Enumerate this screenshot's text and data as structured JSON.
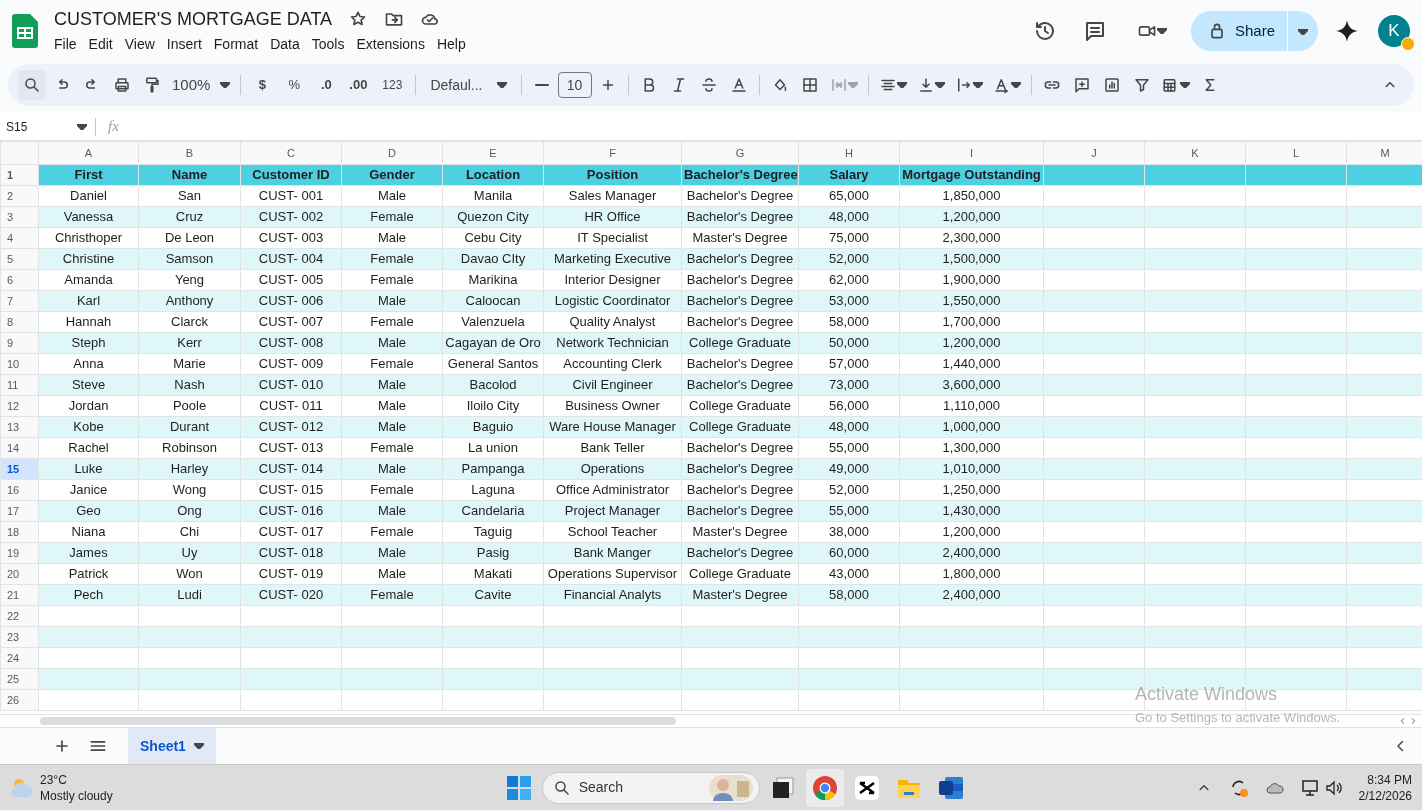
{
  "document": {
    "title": "CUSTOMER'S MORTGAGE DATA",
    "share": "Share",
    "avatar": "K"
  },
  "menu": [
    "File",
    "Edit",
    "View",
    "Insert",
    "Format",
    "Data",
    "Tools",
    "Extensions",
    "Help"
  ],
  "toolbar": {
    "zoom": "100%",
    "currency": "$",
    "percent": "%",
    "decrease_decimals": ".0",
    "increase_decimals": ".00",
    "number_format": "123",
    "font": "Defaul...",
    "font_size": "10"
  },
  "formula_bar": {
    "name_box": "S15",
    "fx": "fx"
  },
  "table": {
    "columns": [
      "A",
      "B",
      "C",
      "D",
      "E",
      "F",
      "G",
      "H",
      "I",
      "J",
      "K",
      "L",
      "M"
    ],
    "rows": [
      {
        "number": "1",
        "selected": false,
        "kind": "header",
        "cells": [
          "First",
          "Name",
          "Customer ID",
          "Gender",
          "Location",
          "Position",
          "Bachelor's Degree",
          "Salary",
          "Mortgage Outstanding"
        ]
      },
      {
        "number": "2",
        "selected": false,
        "kind": "data",
        "cells": [
          "Daniel",
          "San",
          "CUST- 001",
          "Male",
          "Manila",
          "Sales Manager",
          "Bachelor's Degree",
          "65,000",
          "1,850,000"
        ]
      },
      {
        "number": "3",
        "selected": false,
        "kind": "data",
        "cells": [
          "Vanessa",
          "Cruz",
          "CUST- 002",
          "Female",
          "Quezon City",
          "HR Office",
          "Bachelor's Degree",
          "48,000",
          "1,200,000"
        ]
      },
      {
        "number": "4",
        "selected": false,
        "kind": "data",
        "cells": [
          "Christhoper",
          "De Leon",
          "CUST- 003",
          "Male",
          "Cebu City",
          "IT Specialist",
          "Master's Degree",
          "75,000",
          "2,300,000"
        ]
      },
      {
        "number": "5",
        "selected": false,
        "kind": "data",
        "cells": [
          "Christine",
          "Samson",
          "CUST- 004",
          "Female",
          "Davao CIty",
          "Marketing Executive",
          "Bachelor's Degree",
          "52,000",
          "1,500,000"
        ]
      },
      {
        "number": "6",
        "selected": false,
        "kind": "data",
        "cells": [
          "Amanda",
          "Yeng",
          "CUST- 005",
          "Female",
          "Marikina",
          "Interior Designer",
          "Bachelor's Degree",
          "62,000",
          "1,900,000"
        ]
      },
      {
        "number": "7",
        "selected": false,
        "kind": "data",
        "cells": [
          "Karl",
          "Anthony",
          "CUST- 006",
          "Male",
          "Caloocan",
          "Logistic Coordinator",
          "Bachelor's Degree",
          "53,000",
          "1,550,000"
        ]
      },
      {
        "number": "8",
        "selected": false,
        "kind": "data",
        "cells": [
          "Hannah",
          "Clarck",
          "CUST- 007",
          "Female",
          "Valenzuela",
          "Quality Analyst",
          "Bachelor's Degree",
          "58,000",
          "1,700,000"
        ]
      },
      {
        "number": "9",
        "selected": false,
        "kind": "data",
        "cells": [
          "Steph",
          "Kerr",
          "CUST- 008",
          "Male",
          "Cagayan de Oro",
          "Network Technician",
          "College Graduate",
          "50,000",
          "1,200,000"
        ]
      },
      {
        "number": "10",
        "selected": false,
        "kind": "data",
        "cells": [
          "Anna",
          "Marie",
          "CUST- 009",
          "Female",
          "General Santos",
          "Accounting Clerk",
          "Bachelor's Degree",
          "57,000",
          "1,440,000"
        ]
      },
      {
        "number": "11",
        "selected": false,
        "kind": "data",
        "cells": [
          "Steve",
          "Nash",
          "CUST- 010",
          "Male",
          "Bacolod",
          "Civil Engineer",
          "Bachelor's Degree",
          "73,000",
          "3,600,000"
        ]
      },
      {
        "number": "12",
        "selected": false,
        "kind": "data",
        "cells": [
          "Jordan",
          "Poole",
          "CUST- 011",
          "Male",
          "Iloilo City",
          "Business Owner",
          "College Graduate",
          "56,000",
          "1,110,000"
        ]
      },
      {
        "number": "13",
        "selected": false,
        "kind": "data",
        "cells": [
          "Kobe",
          "Durant",
          "CUST- 012",
          "Male",
          "Baguio",
          "Ware House Manager",
          "College Graduate",
          "48,000",
          "1,000,000"
        ]
      },
      {
        "number": "14",
        "selected": false,
        "kind": "data",
        "cells": [
          "Rachel",
          "Robinson",
          "CUST- 013",
          "Female",
          "La union",
          "Bank Teller",
          "Bachelor's Degree",
          "55,000",
          "1,300,000"
        ]
      },
      {
        "number": "15",
        "selected": true,
        "kind": "data",
        "cells": [
          "Luke",
          "Harley",
          "CUST- 014",
          "Male",
          "Pampanga",
          "Operations",
          "Bachelor's Degree",
          "49,000",
          "1,010,000"
        ]
      },
      {
        "number": "16",
        "selected": false,
        "kind": "data",
        "cells": [
          "Janice",
          "Wong",
          "CUST- 015",
          "Female",
          "Laguna",
          "Office Administrator",
          "Bachelor's Degree",
          "52,000",
          "1,250,000"
        ]
      },
      {
        "number": "17",
        "selected": false,
        "kind": "data",
        "cells": [
          "Geo",
          "Ong",
          "CUST- 016",
          "Male",
          "Candelaria",
          "Project Manager",
          "Bachelor's Degree",
          "55,000",
          "1,430,000"
        ]
      },
      {
        "number": "18",
        "selected": false,
        "kind": "data",
        "cells": [
          "Niana",
          "Chi",
          "CUST- 017",
          "Female",
          "Taguig",
          "School Teacher",
          "Master's Degree",
          "38,000",
          "1,200,000"
        ]
      },
      {
        "number": "19",
        "selected": false,
        "kind": "data",
        "cells": [
          "James",
          "Uy",
          "CUST- 018",
          "Male",
          "Pasig",
          "Bank Manger",
          "Bachelor's Degree",
          "60,000",
          "2,400,000"
        ]
      },
      {
        "number": "20",
        "selected": false,
        "kind": "data",
        "cells": [
          "Patrick",
          "Won",
          "CUST- 019",
          "Male",
          "Makati",
          "Operations Supervisor",
          "College Graduate",
          "43,000",
          "1,800,000"
        ]
      },
      {
        "number": "21",
        "selected": false,
        "kind": "data",
        "cells": [
          "Pech",
          "Ludi",
          "CUST- 020",
          "Female",
          "Cavite",
          "Financial Analyts",
          "Master's Degree",
          "58,000",
          "2,400,000"
        ]
      },
      {
        "number": "22",
        "selected": false,
        "kind": "data"
      },
      {
        "number": "23",
        "selected": false,
        "kind": "data"
      },
      {
        "number": "24",
        "selected": false,
        "kind": "data"
      },
      {
        "number": "25",
        "selected": false,
        "kind": "data"
      },
      {
        "number": "26",
        "selected": false,
        "kind": "data"
      }
    ]
  },
  "sheet_tabs": [
    {
      "label": "Sheet1",
      "selected": true
    }
  ],
  "activation_notice": {
    "title": "Activate Windows",
    "message": "Go to Settings to activate Windows."
  },
  "taskbar": {
    "weather": {
      "temperature": "23°C",
      "condition": "Mostly cloudy"
    },
    "search": "Search",
    "time": "8:34 PM",
    "date": "2/12/2026"
  }
}
